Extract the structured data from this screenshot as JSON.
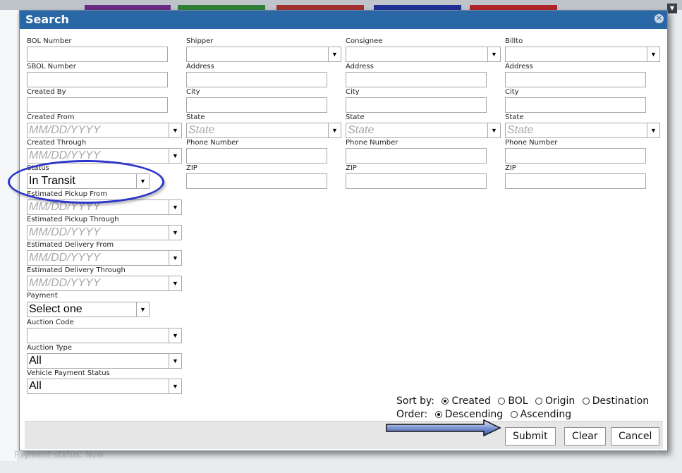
{
  "bg": {
    "tab_colors": [
      "#6a2c84",
      "#2f7e36",
      "#a13131",
      "#1f2f93",
      "#b0252a"
    ],
    "bottom_status": "Payment status: New"
  },
  "modal": {
    "title": "Search",
    "close_icon": "close-icon"
  },
  "fields": {
    "bol_number": {
      "label": "BOL Number",
      "value": ""
    },
    "sbol_number": {
      "label": "SBOL Number",
      "value": ""
    },
    "created_by": {
      "label": "Created By",
      "value": ""
    },
    "created_from": {
      "label": "Created From",
      "placeholder": "MM/DD/YYYY"
    },
    "created_through": {
      "label": "Created Through",
      "placeholder": "MM/DD/YYYY"
    },
    "status": {
      "label": "Status",
      "value": "In Transit"
    },
    "est_pickup_from": {
      "label": "Estimated Pickup From",
      "placeholder": "MM/DD/YYYY"
    },
    "est_pickup_through": {
      "label": "Estimated Pickup Through",
      "placeholder": "MM/DD/YYYY"
    },
    "est_delivery_from": {
      "label": "Estimated Delivery From",
      "placeholder": "MM/DD/YYYY"
    },
    "est_delivery_through": {
      "label": "Estimated Delivery Through",
      "placeholder": "MM/DD/YYYY"
    },
    "payment": {
      "label": "Payment",
      "value": "Select one"
    },
    "auction_code": {
      "label": "Auction Code",
      "value": ""
    },
    "auction_type": {
      "label": "Auction Type",
      "value": "All"
    },
    "vehicle_payment_status": {
      "label": "Vehicle Payment Status",
      "value": "All"
    }
  },
  "parties": [
    {
      "key": "shipper",
      "label": "Shipper"
    },
    {
      "key": "consignee",
      "label": "Consignee"
    },
    {
      "key": "billto",
      "label": "Billto"
    }
  ],
  "party_fields": {
    "address": "Address",
    "city": "City",
    "state": "State",
    "state_placeholder": "State",
    "phone": "Phone Number",
    "zip": "ZIP"
  },
  "sort": {
    "sort_label": "Sort by:",
    "options": [
      "Created",
      "BOL",
      "Origin",
      "Destination"
    ],
    "selected": "Created",
    "order_label": "Order:",
    "order_options": [
      "Descending",
      "Ascending"
    ],
    "order_selected": "Descending"
  },
  "buttons": {
    "submit": "Submit",
    "clear": "Clear",
    "cancel": "Cancel"
  },
  "annotation_colors": {
    "circle": "#2b35c9",
    "arrow": "#6f86c9"
  }
}
